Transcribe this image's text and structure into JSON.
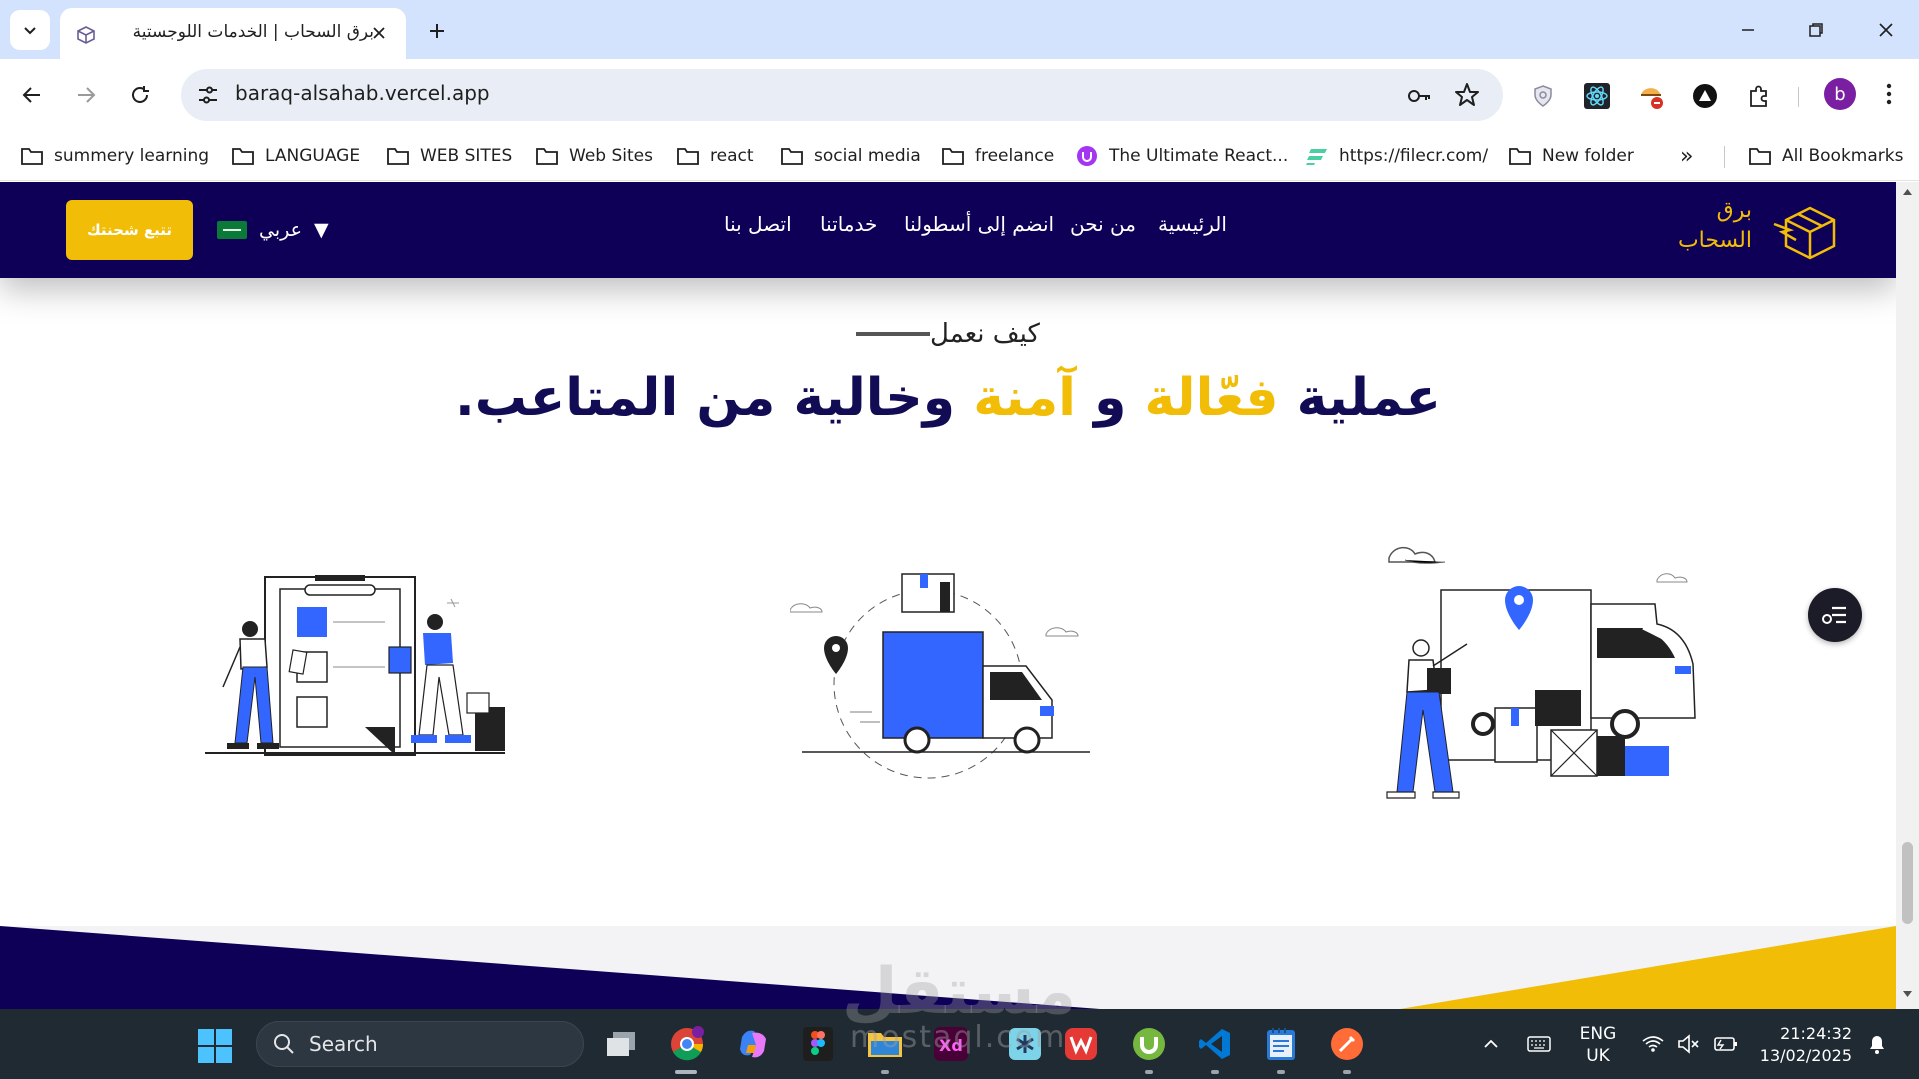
{
  "browser": {
    "tab_title": "برق السحاب | الخدمات اللوجستية",
    "url": "baraq-alsahab.vercel.app",
    "profile_initial": "b",
    "bookmarks": [
      {
        "label": "summery learning",
        "icon": "folder-icon"
      },
      {
        "label": "LANGUAGE",
        "icon": "folder-icon"
      },
      {
        "label": "WEB SITES",
        "icon": "folder-icon"
      },
      {
        "label": "Web Sites",
        "icon": "folder-icon"
      },
      {
        "label": "react",
        "icon": "folder-icon"
      },
      {
        "label": "social media",
        "icon": "folder-icon"
      },
      {
        "label": "freelance",
        "icon": "folder-icon"
      },
      {
        "label": "The Ultimate React...",
        "icon": "udemy-icon"
      },
      {
        "label": "https://filecr.com/",
        "icon": "filecr-icon"
      },
      {
        "label": "New folder",
        "icon": "folder-icon"
      }
    ],
    "more_bookmarks": "»",
    "all_bookmarks": "All Bookmarks"
  },
  "site": {
    "brand_line1": "برق",
    "brand_line2": "السحاب",
    "nav": [
      "الرئيسية",
      "من نحن",
      "انضم إلى أسطولنا",
      "خدماتنا",
      "اتصل بنا"
    ],
    "language": "عربي",
    "language_caret": "▼",
    "track_button": "تتبع شحنتك",
    "section": {
      "eyebrow": "كيف نعمل",
      "title_part1": "عملية",
      "title_part2": "فعّالة",
      "title_part3": "و",
      "title_part4": "آمنة",
      "title_part5": "وخالية من المتاعب."
    }
  },
  "watermark": {
    "main": "مستقل",
    "sub": "mostaql.com"
  },
  "taskbar": {
    "search_placeholder": "Search",
    "lang_line1": "ENG",
    "lang_line2": "UK",
    "time": "21:24:32",
    "date": "13/02/2025"
  },
  "colors": {
    "header_bg": "#0f0057",
    "accent_yellow": "#f1bd07",
    "illustration_blue": "#3366ff",
    "title_navy": "#120c55"
  }
}
